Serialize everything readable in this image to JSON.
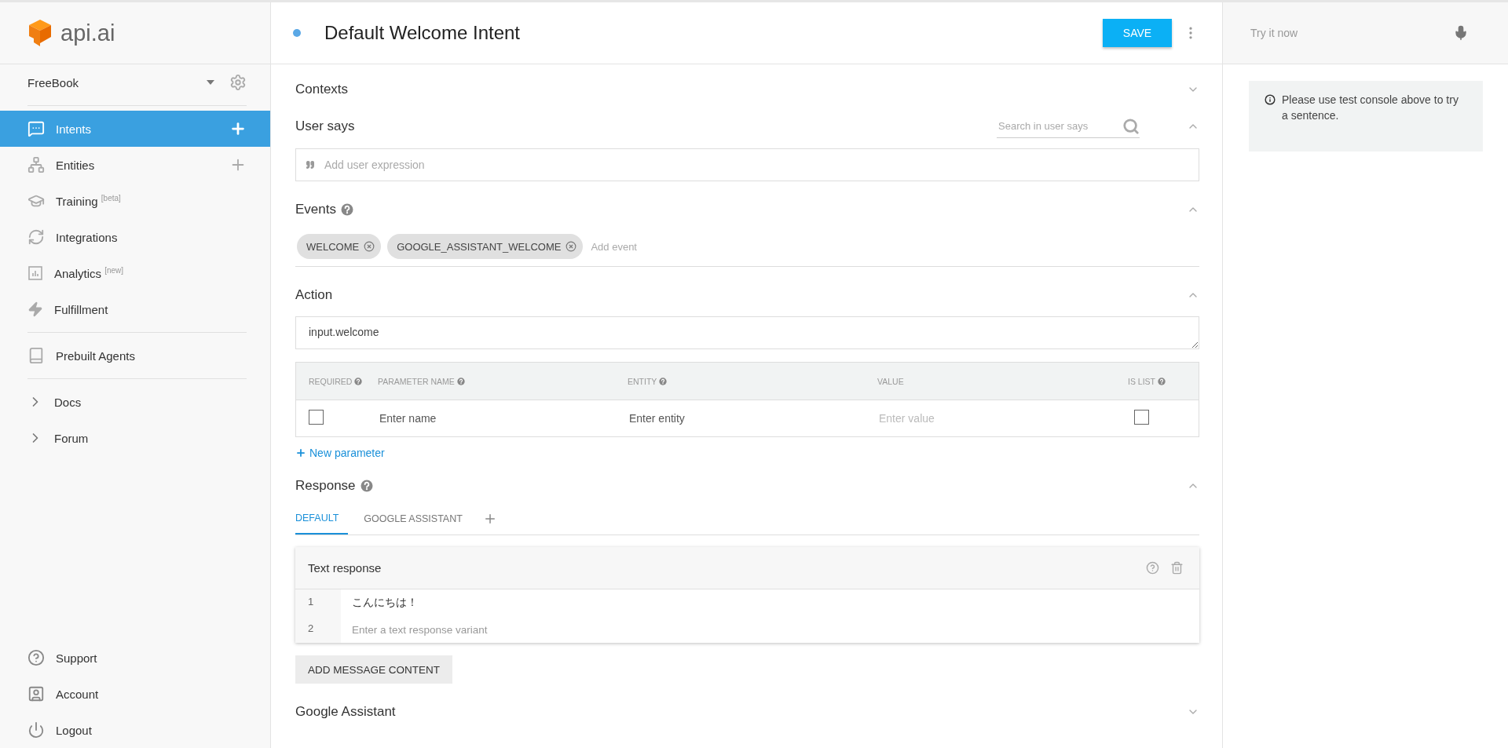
{
  "logo": {
    "text": "api.ai"
  },
  "agent": {
    "name": "FreeBook"
  },
  "nav_groups": [
    {
      "items": [
        {
          "label": "Intents",
          "selected": true,
          "has_add": true
        },
        {
          "label": "Entities",
          "selected": false,
          "has_add": true
        },
        {
          "label": "Training $^{[beta]}$",
          "selected": false,
          "has_add": false
        },
        {
          "label": "Integrations",
          "selected": false,
          "has_add": false
        },
        {
          "label": "Analytics $^{[new]}$",
          "selected": false,
          "has_add": false
        },
        {
          "label": "Fulfillment",
          "selected": false,
          "has_add": false
        }
      ]
    },
    {
      "items": [
        {
          "label": "Prebuilt Agents",
          "selected": false,
          "has_add": false
        }
      ]
    },
    {
      "items": [
        {
          "label": "Docs",
          "selected": false,
          "has_add": false
        },
        {
          "label": "Forum",
          "selected": false,
          "has_add": false
        }
      ]
    }
  ],
  "footer_nav": [
    {
      "label": "Support"
    },
    {
      "label": "Account"
    },
    {
      "label": "Logout"
    }
  ],
  "header": {
    "title": "Default Welcome Intent",
    "save_button": "SAVE"
  },
  "sections": {
    "contexts": {
      "title": "Contexts",
      "expanded": false
    },
    "user_says": {
      "title": "User says",
      "expanded": true,
      "search_placeholder": "Search in user says",
      "input_placeholder": "Add user expression"
    },
    "events": {
      "title": "Events",
      "expanded": true,
      "help": true,
      "chips": [
        "WELCOME",
        "GOOGLE_ASSISTANT_WELCOME"
      ],
      "placeholder": "Add event"
    },
    "action": {
      "title": "Action",
      "expanded": true,
      "value": "input.welcome",
      "columns": [
        {
          "label": "REQUIRED",
          "help": true
        },
        {
          "label": "PARAMETER NAME",
          "help": true
        },
        {
          "label": "ENTITY",
          "help": true
        },
        {
          "label": "VALUE",
          "help": false
        },
        {
          "label": "IS LIST",
          "help": true
        }
      ],
      "rows": [
        {
          "required": false,
          "name_placeholder": "Enter name",
          "entity_placeholder": "Enter entity",
          "value_placeholder": "Enter value",
          "is_list": false
        }
      ],
      "new_parameter": "New parameter"
    },
    "response": {
      "title": "Response",
      "expanded": true,
      "help": true,
      "tabs": [
        {
          "label": "DEFAULT",
          "selected": true
        },
        {
          "label": "GOOGLE ASSISTANT",
          "selected": false
        }
      ],
      "card_title": "Text response",
      "lines": [
        {
          "number": "1",
          "value": "こんにちは！"
        },
        {
          "number": "2",
          "placeholder": "Enter a text response variant"
        }
      ],
      "add_button": "ADD MESSAGE CONTENT"
    },
    "google_assistant": {
      "title": "Google Assistant",
      "expanded": false
    }
  },
  "console": {
    "placeholder": "Try it now",
    "info": "Please use test console above to try a sentence."
  }
}
